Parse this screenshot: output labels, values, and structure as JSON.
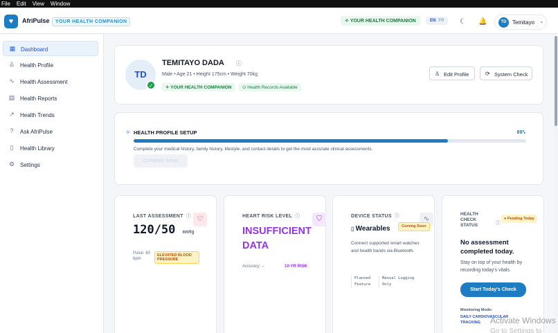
{
  "menubar": {
    "items": [
      "File",
      "Edit",
      "View",
      "Window"
    ]
  },
  "header": {
    "brand": "AfriPulse",
    "tagline": "YOUR HEALTH COMPANION",
    "pill": "YOUR HEALTH COMPANION",
    "lang": [
      "EN",
      "FR"
    ],
    "user": "Temitayo",
    "user_initials": "TD"
  },
  "sidebar": {
    "items": [
      {
        "label": "Dashboard",
        "icon": "grid-icon",
        "glyph": "▦",
        "active": true
      },
      {
        "label": "Health Profile",
        "icon": "user-icon",
        "glyph": "👤",
        "active": false
      },
      {
        "label": "Health Assessment",
        "icon": "activity-icon",
        "glyph": "∿",
        "active": false
      },
      {
        "label": "Health Reports",
        "icon": "document-icon",
        "glyph": "▤",
        "active": false
      },
      {
        "label": "Health Trends",
        "icon": "trend-icon",
        "glyph": "↗",
        "active": false
      },
      {
        "label": "Ask AfriPulse",
        "icon": "help-icon",
        "glyph": "?",
        "active": false
      },
      {
        "label": "Health Library",
        "icon": "book-icon",
        "glyph": "📖",
        "active": false
      },
      {
        "label": "Settings",
        "icon": "gear-icon",
        "glyph": "⚙",
        "active": false
      }
    ]
  },
  "profile": {
    "initials": "TD",
    "name": "TEMITAYO DADA",
    "meta": "Male • Age 21 • Height 175cm • Weight 70kg",
    "badge1": "YOUR HEALTH COMPANION",
    "badge2": "Health Records Available",
    "edit_label": "Edit Profile",
    "check_label": "System Check"
  },
  "setup": {
    "title": "HEALTH PROFILE SETUP",
    "percent": "80%",
    "progress": 80,
    "desc": "Complete your medical history, family history, lifestyle, and contact details to get the most accurate clinical assessments.",
    "button": "Complete Setup"
  },
  "last_assessment": {
    "title": "LAST ASSESSMENT",
    "bp": "120/50",
    "unit": "mmHg",
    "pulse": "Pulse: 60 bpm",
    "status": "ELEVATED BLOOD PRESSURE"
  },
  "heart_risk": {
    "title": "HEART RISK LEVEL",
    "value": "INSUFFICIENT DATA",
    "accuracy": "Accuracy: --",
    "risk": "10-YR RISK"
  },
  "device": {
    "title": "DEVICE STATUS",
    "name": "Wearables",
    "badge": "Coming Soon",
    "desc": "Connect supported smart watches and health bands via Bluetooth.",
    "tag1": "Planned Feature",
    "tag2": "Manual Logging Only"
  },
  "health_check": {
    "title": "HEALTH CHECK STATUS",
    "badge": "Pending Today",
    "headline": "No assessment completed today.",
    "desc": "Stay on top of your health by recording today's vitals.",
    "button": "Start Today's Check",
    "mode_label": "Monitoring Mode:",
    "mode": "DAILY CARDIOVASCULAR TRACKING"
  },
  "watermark": {
    "line1": "Activate Windows",
    "line2": "Go to Settings to activate Windows."
  }
}
